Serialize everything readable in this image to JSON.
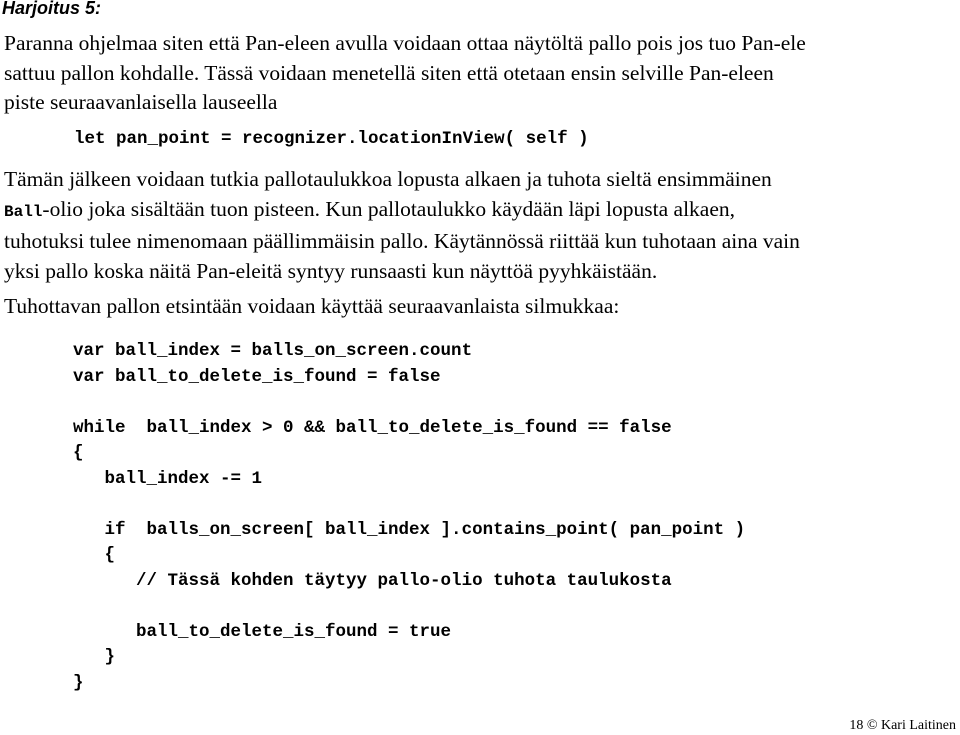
{
  "heading": "Harjoitus 5:",
  "intro_lines": [
    "Paranna ohjelmaa siten että Pan-eleen avulla voidaan ottaa näytöltä pallo pois jos tuo Pan-ele",
    "sattuu pallon kohdalle. Tässä voidaan menetellä siten että otetaan ensin selville Pan-eleen",
    "piste seuraavanlaisella lauseella"
  ],
  "code_statement": "let pan_point = recognizer.locationInView( self )",
  "explanation": {
    "line1": "Tämän jälkeen voidaan tutkia pallotaulukkoa lopusta alkaen ja tuhota sieltä ensimmäinen",
    "line2_code": "Ball",
    "line2_rest": "-olio joka sisältään tuon pisteen. Kun pallotaulukko käydään läpi lopusta alkaen,",
    "line3": "tuhotuksi tulee nimenomaan päällimmäisin pallo. Käytännössä riittää kun tuhotaan aina vain",
    "line4": "yksi pallo koska näitä Pan-eleitä syntyy runsaasti kun näyttöä pyyhkäistään."
  },
  "loop_intro": "Tuhottavan pallon etsintään voidaan käyttää seuraavanlaista silmukkaa:",
  "code_lines": [
    "var ball_index = balls_on_screen.count",
    "var ball_to_delete_is_found = false",
    "",
    "while  ball_index > 0 && ball_to_delete_is_found == false",
    "{",
    "   ball_index -= 1",
    "",
    "   if  balls_on_screen[ ball_index ].contains_point( pan_point )",
    "   {",
    "      // Tässä kohden täytyy pallo-olio tuhota taulukosta",
    "",
    "      ball_to_delete_is_found = true",
    "   }",
    "}"
  ],
  "footer": {
    "page_number": "18",
    "copyright": "© Kari Laitinen"
  }
}
